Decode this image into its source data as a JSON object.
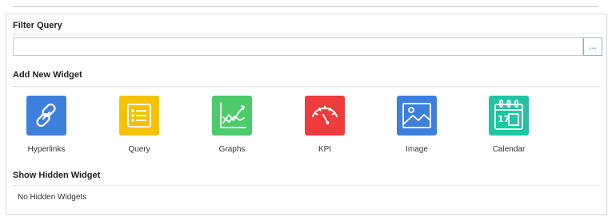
{
  "filter_query": {
    "title": "Filter Query",
    "value": "",
    "placeholder": "",
    "browse_label": "..."
  },
  "add_widget": {
    "title": "Add New Widget",
    "items": [
      {
        "label": "Hyperlinks",
        "icon": "link-icon",
        "color": "#3d7fdc"
      },
      {
        "label": "Query",
        "icon": "list-icon",
        "color": "#f5c200"
      },
      {
        "label": "Graphs",
        "icon": "line-chart-icon",
        "color": "#4ccb6a"
      },
      {
        "label": "KPI",
        "icon": "gauge-icon",
        "color": "#ef3b3b"
      },
      {
        "label": "Image",
        "icon": "image-icon",
        "color": "#3d7fdc"
      },
      {
        "label": "Calendar",
        "icon": "calendar-icon",
        "color": "#22c3a3"
      }
    ]
  },
  "hidden_widgets": {
    "title": "Show Hidden Widget",
    "empty_text": "No Hidden Widgets"
  }
}
